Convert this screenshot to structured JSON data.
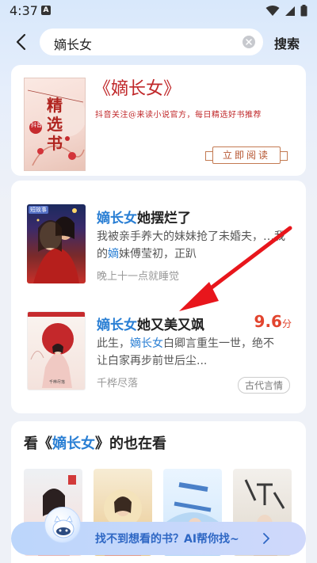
{
  "status_bar": {
    "time": "4:37",
    "notification_icon": "A"
  },
  "search": {
    "query": "嫡长女",
    "button": "搜索"
  },
  "promo": {
    "title": "《嫡长女》",
    "subtitle": "抖音关注@来读小说官方，每日精选好书推荐",
    "read_button": "立即阅读",
    "cover_text": "精选书",
    "cover_tag": "抖音"
  },
  "results": [
    {
      "title_highlight": "嫡长女",
      "title_rest": "她摆烂了",
      "desc_line1": "我被亲手养大的妹妹抢了未婚夫，…我",
      "desc_line2_pre": "的",
      "desc_line2_hl": "嫡",
      "desc_line2_post": "妹傅莹初，正趴",
      "author": "晚上十一点就睡觉",
      "cover_badge": "短故事"
    },
    {
      "title_highlight": "嫡长女",
      "title_rest": "她又美又飒",
      "score": "9.6",
      "score_unit": "分",
      "desc_line1_pre": "此生，",
      "desc_line1_hl": "嫡长女",
      "desc_line1_post": "白卿言重生一世，绝不",
      "desc_line2": "让白家再步前世后尘...",
      "author": "千桦尽落",
      "tag": "古代言情"
    }
  ],
  "also_watching": {
    "title_pre": "看《",
    "title_hl": "嫡长女",
    "title_post": "》的也在看"
  },
  "ai_banner": {
    "text": "找不到想看的书？AI帮你找~"
  },
  "colors": {
    "highlight": "#2a7fd4",
    "score": "#e2452f",
    "promo_red": "#c0282a",
    "arrow": "#e8161c"
  }
}
